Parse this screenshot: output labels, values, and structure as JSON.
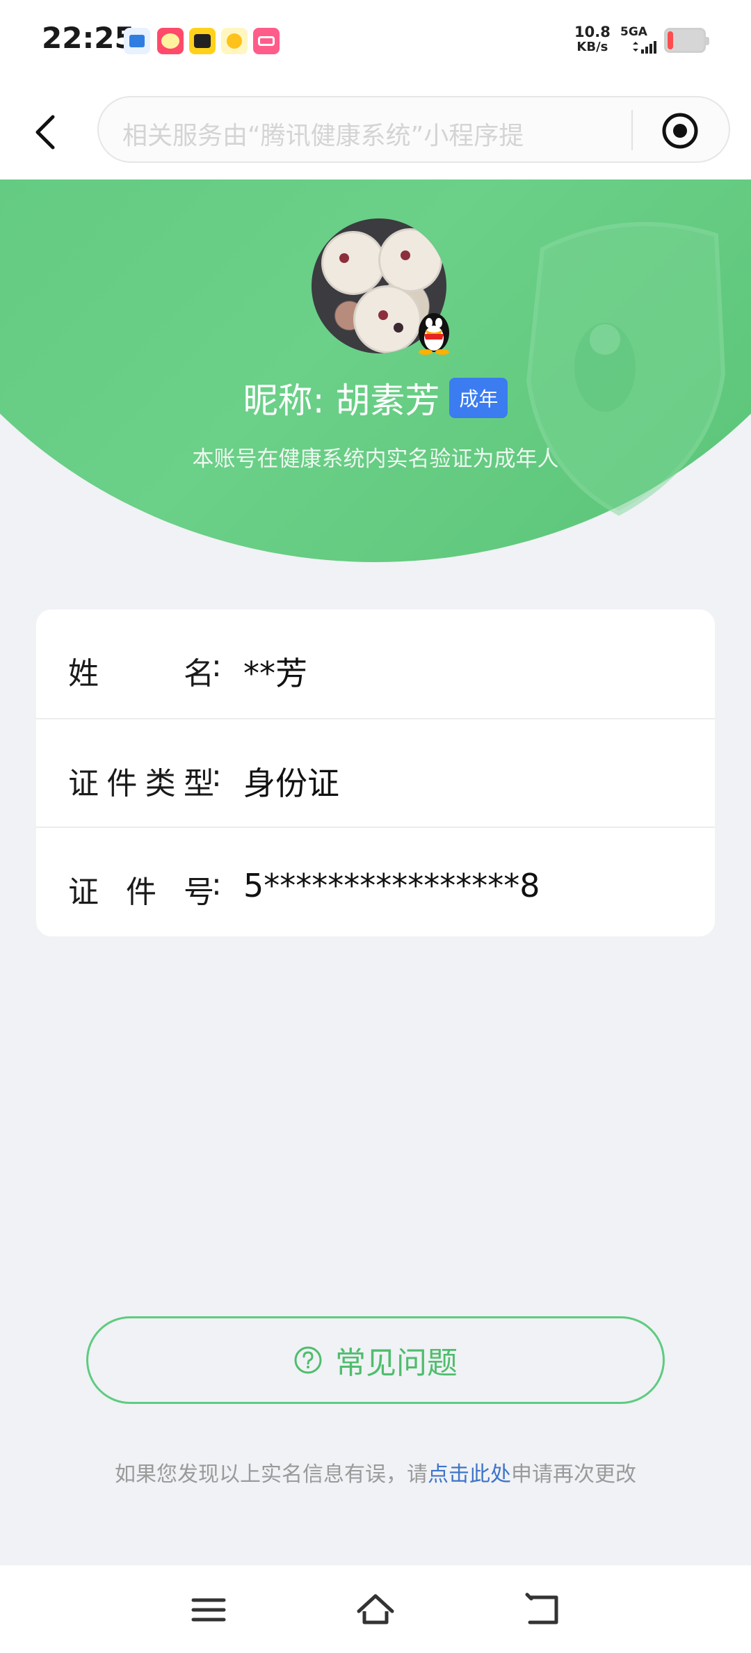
{
  "status_bar": {
    "time": "22:25",
    "net_speed_value": "10.8",
    "net_speed_unit": "KB/s",
    "network_type": "5GA"
  },
  "nav": {
    "search_placeholder": "相关服务由“腾讯健康系统”小程序提"
  },
  "profile": {
    "nickname": "昵称: 胡素芳",
    "badge": "成年",
    "subtitle": "本账号在健康系统内实名验证为成年人"
  },
  "info": {
    "rows": [
      {
        "label_chars": [
          "姓",
          "名"
        ],
        "value": "**芳"
      },
      {
        "label_chars": [
          "证",
          "件",
          "类",
          "型"
        ],
        "value": "身份证"
      },
      {
        "label_chars": [
          "证",
          "件",
          "号"
        ],
        "value": "5****************8"
      }
    ],
    "colon": ":"
  },
  "faq_button": {
    "label": "常见问题"
  },
  "footnote": {
    "before": "如果您发现以上实名信息有误，请",
    "link": "点击此处",
    "after": "申请再次更改"
  },
  "colors": {
    "brand_green": "#5bc47a",
    "badge_blue": "#3b7cf0",
    "link_blue": "#3f74c9"
  }
}
